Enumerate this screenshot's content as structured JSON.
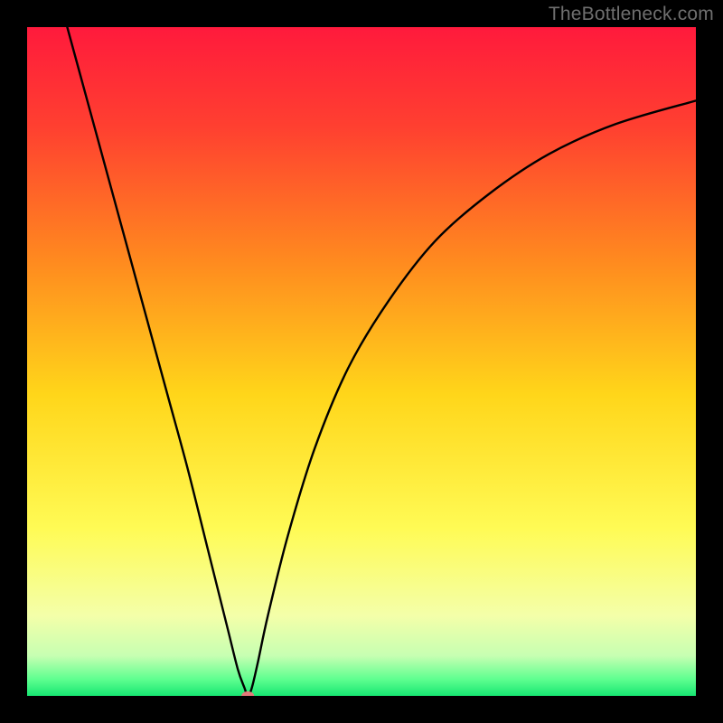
{
  "watermark": "TheBottleneck.com",
  "chart_data": {
    "type": "line",
    "title": "",
    "xlabel": "",
    "ylabel": "",
    "xlim": [
      0,
      100
    ],
    "ylim": [
      0,
      100
    ],
    "grid": false,
    "legend": false,
    "background_gradient": {
      "stops": [
        {
          "offset": 0.0,
          "color": "#ff1a3c"
        },
        {
          "offset": 0.15,
          "color": "#ff4030"
        },
        {
          "offset": 0.35,
          "color": "#ff8a1f"
        },
        {
          "offset": 0.55,
          "color": "#ffd61a"
        },
        {
          "offset": 0.75,
          "color": "#fffb55"
        },
        {
          "offset": 0.88,
          "color": "#f4ffa9"
        },
        {
          "offset": 0.94,
          "color": "#c7ffb2"
        },
        {
          "offset": 0.975,
          "color": "#5fff90"
        },
        {
          "offset": 1.0,
          "color": "#17e672"
        }
      ]
    },
    "curve": {
      "description": "bottleneck-profile",
      "x": [
        6,
        9,
        12,
        15,
        18,
        21,
        24,
        27,
        30,
        31.5,
        32.5,
        33,
        33.6,
        34.5,
        36,
        39,
        43,
        48,
        54,
        61,
        69,
        78,
        88,
        100
      ],
      "y": [
        100,
        89,
        78,
        67,
        56,
        45,
        34,
        22,
        10,
        4,
        1.2,
        0,
        1.2,
        5,
        12,
        24,
        37,
        49,
        59,
        68,
        75,
        81,
        85.5,
        89
      ]
    },
    "marker": {
      "x": 33,
      "y": 0,
      "rx": 7,
      "ry": 5,
      "color": "#e47a7a"
    }
  }
}
